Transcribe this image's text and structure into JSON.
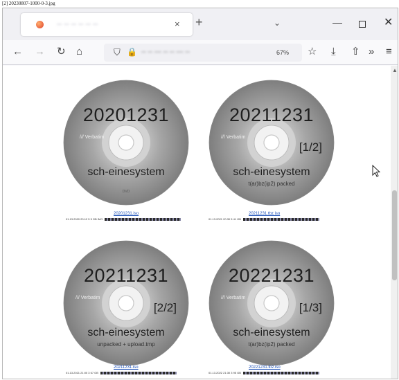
{
  "image_caption": "[2] 20230807-1000-0-3.jpg",
  "browser": {
    "tab": {
      "title": "-- -- -- -- -- --",
      "close_glyph": "×"
    },
    "new_tab_glyph": "+",
    "tab_list_glyph": "⌄",
    "window": {
      "minimize": "—",
      "close": "✕"
    },
    "nav": {
      "back": "←",
      "forward": "→",
      "reload": "↻",
      "home": "⌂"
    },
    "url": {
      "shield": "⛉",
      "lock": "🔒",
      "text": "-- -- --- -- -- --- --",
      "zoom": "67%"
    },
    "toolbar": {
      "bookmark": "☆",
      "download": "⤓",
      "extensions": "⇧",
      "overflow": "»",
      "menu": "≡"
    }
  },
  "discs": [
    {
      "date": "20201231",
      "part": "",
      "system": "sch-einesystem",
      "subtitle": "",
      "brand": "/// Verbatim",
      "dvd": "DVD",
      "link": "20201231.iso",
      "meta": "01.13.2020 20:12  5 5 GB  IMG"
    },
    {
      "date": "20211231",
      "part": "[1/2]",
      "system": "sch-einesystem",
      "subtitle": "t(ar)bz(ip2) packed",
      "brand": "/// Verbatim",
      "dvd": "DVD",
      "link": "20211231.tbz.iso",
      "meta": "01.13.2021 20:30  5 41 GB"
    },
    {
      "date": "20211231",
      "part": "[2/2]",
      "system": "sch-einesystem",
      "subtitle": "unpacked + upload.tmp",
      "brand": "/// Verbatim",
      "dvd": "DVD",
      "link": "20211231.iso",
      "meta": "01.13.2021 21:00  3 67 GB"
    },
    {
      "date": "20221231",
      "part": "[1/3]",
      "system": "sch-einesystem",
      "subtitle": "t(ar)bz(ip2) packed",
      "brand": "/// Verbatim",
      "dvd": "DVD",
      "link": "20221231.tbz.iso",
      "meta": "01.13.2022 21:30  3 95 GB"
    }
  ]
}
